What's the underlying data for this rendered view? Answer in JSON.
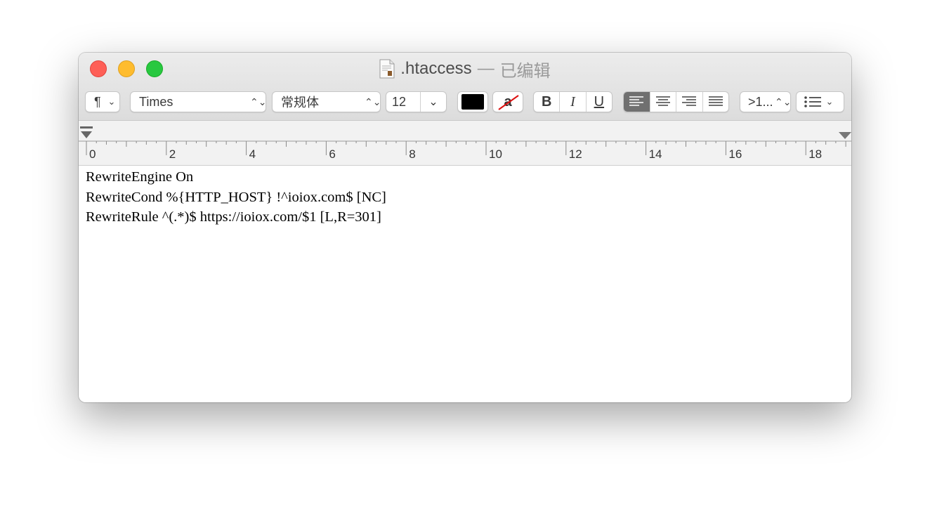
{
  "window": {
    "title": ".htaccess",
    "separator": "—",
    "status": "已编辑"
  },
  "toolbar": {
    "paragraph_symbol": "¶",
    "font_family": "Times",
    "font_style": "常规体",
    "font_size": "12",
    "text_color": "#000000",
    "highlight_glyph": "a",
    "bold": "B",
    "italic": "I",
    "underline": "U",
    "alignment_selected": "left",
    "spacing_label": ">1...",
    "list_icon": "list-icon"
  },
  "ruler": {
    "labels": [
      "0",
      "2",
      "4",
      "6",
      "8",
      "10",
      "12",
      "14",
      "16",
      "18"
    ]
  },
  "document": {
    "lines": [
      "RewriteEngine On",
      "RewriteCond %{HTTP_HOST} !^ioiox.com$ [NC]",
      "RewriteRule ^(.*)$ https://ioiox.com/$1 [L,R=301]"
    ]
  }
}
